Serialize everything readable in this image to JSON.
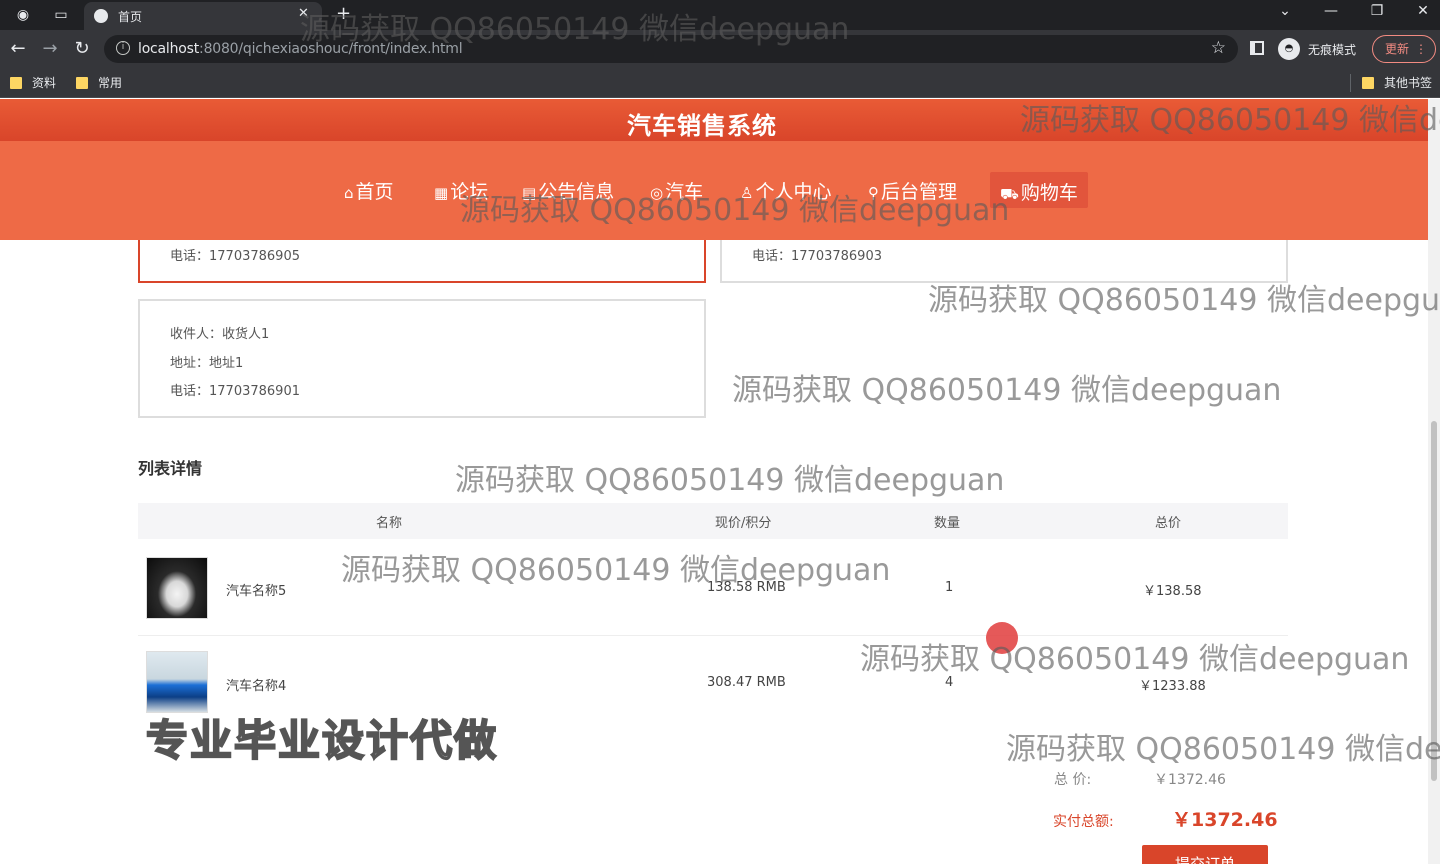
{
  "browser": {
    "tab_title": "首页",
    "url_host": "localhost",
    "url_rest": ":8080/qichexiaoshouc/front/index.html",
    "incognito_label": "无痕模式",
    "update_label": "更新",
    "bookmarks": [
      "资料",
      "常用"
    ],
    "other_bookmarks": "其他书签"
  },
  "site": {
    "title": "汽车销售系统",
    "nav": [
      {
        "label": "首页",
        "icon": "home-icon"
      },
      {
        "label": "论坛",
        "icon": "grid-icon"
      },
      {
        "label": "公告信息",
        "icon": "notice-icon"
      },
      {
        "label": "汽车",
        "icon": "car-icon"
      },
      {
        "label": "个人中心",
        "icon": "user-icon"
      },
      {
        "label": "后台管理",
        "icon": "link-icon"
      },
      {
        "label": "购物车",
        "icon": "cart-icon"
      }
    ],
    "active_nav": "购物车"
  },
  "addresses": [
    {
      "phone": "电话：17703786905"
    },
    {
      "phone": "电话：17703786903"
    },
    {
      "recipient": "收件人：收货人1",
      "address": "地址：地址1",
      "phone": "电话：17703786901"
    }
  ],
  "cart": {
    "section_title": "列表详情",
    "headers": {
      "name": "名称",
      "price": "现价/积分",
      "qty": "数量",
      "total": "总价"
    },
    "items": [
      {
        "name": "汽车名称5",
        "price": "138.58 RMB",
        "qty": "1",
        "total": "￥138.58"
      },
      {
        "name": "汽车名称4",
        "price": "308.47 RMB",
        "qty": "4",
        "total": "￥1233.88"
      }
    ],
    "total_label": "总   价:",
    "total_value": "￥1372.46",
    "pay_label": "实付总额:",
    "pay_value": "￥1372.46",
    "submit_label": "提交订单"
  },
  "overlays": {
    "watermark": "源码获取 QQ86050149 微信deepguan",
    "promo": "专业毕业设计代做"
  }
}
